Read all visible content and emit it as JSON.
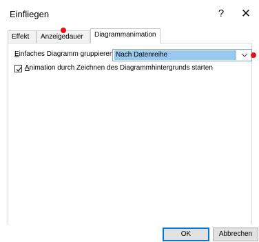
{
  "window": {
    "title": "Einfliegen",
    "help_label": "?",
    "close_label": "✕"
  },
  "tabs": [
    {
      "label": "Effekt",
      "selected": false
    },
    {
      "label": "Anzeigedauer",
      "selected": false
    },
    {
      "label": "Diagrammanimation",
      "selected": true
    }
  ],
  "group": {
    "label_access": "E",
    "label_rest": "infaches Diagramm gruppieren:",
    "selected_value": "Nach Datenreihe"
  },
  "animation": {
    "checked": true,
    "label_access": "A",
    "label_rest": "nimation durch Zeichnen des Diagrammhintergrunds starten"
  },
  "buttons": {
    "ok": "OK",
    "cancel": "Abbrechen"
  },
  "colors": {
    "select_highlight": "#99c9ef",
    "ok_border": "#0078d7",
    "marker": "#e01414"
  }
}
